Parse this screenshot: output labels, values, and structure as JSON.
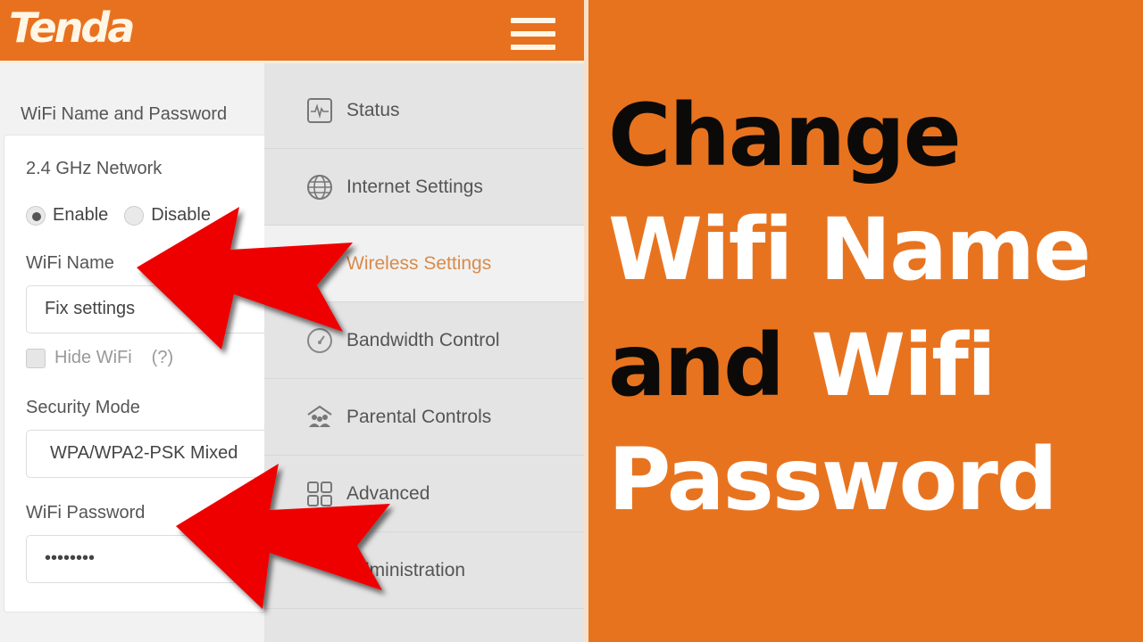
{
  "router": {
    "brand": "Tenda",
    "menu_icon": "hamburger-menu-icon",
    "section_title": "WiFi Name and Password",
    "network_label": "2.4 GHz Network",
    "radio_enable": "Enable",
    "radio_disable": "Disable",
    "radio_selected": "Enable",
    "wifi_name_label": "WiFi Name",
    "wifi_name_value": "Fix settings",
    "hide_wifi_label": "Hide WiFi",
    "hide_wifi_help": "(?)",
    "hide_wifi_checked": false,
    "security_mode_label": "Security Mode",
    "security_mode_value": "WPA/WPA2-PSK Mixed",
    "wifi_password_label": "WiFi Password",
    "wifi_password_value": "••••••••"
  },
  "menu": {
    "items": [
      {
        "label": "Status",
        "icon": "status-pulse-icon"
      },
      {
        "label": "Internet Settings",
        "icon": "globe-icon"
      },
      {
        "label": "Wireless Settings",
        "icon": "wifi-icon",
        "active": true
      },
      {
        "label": "Bandwidth Control",
        "icon": "gauge-icon"
      },
      {
        "label": "Parental Controls",
        "icon": "family-icon"
      },
      {
        "label": "Advanced",
        "icon": "grid-icon"
      },
      {
        "label": "Administration",
        "icon": "gear-icon"
      }
    ]
  },
  "title": {
    "line1": "Change",
    "line2": "Wifi Name",
    "line3_black": "and",
    "line3_white": "Wifi",
    "line4": "Password"
  },
  "colors": {
    "brand_orange": "#e8731f",
    "active_menu_text": "#d98a4a",
    "arrow_red": "#ee0000"
  }
}
